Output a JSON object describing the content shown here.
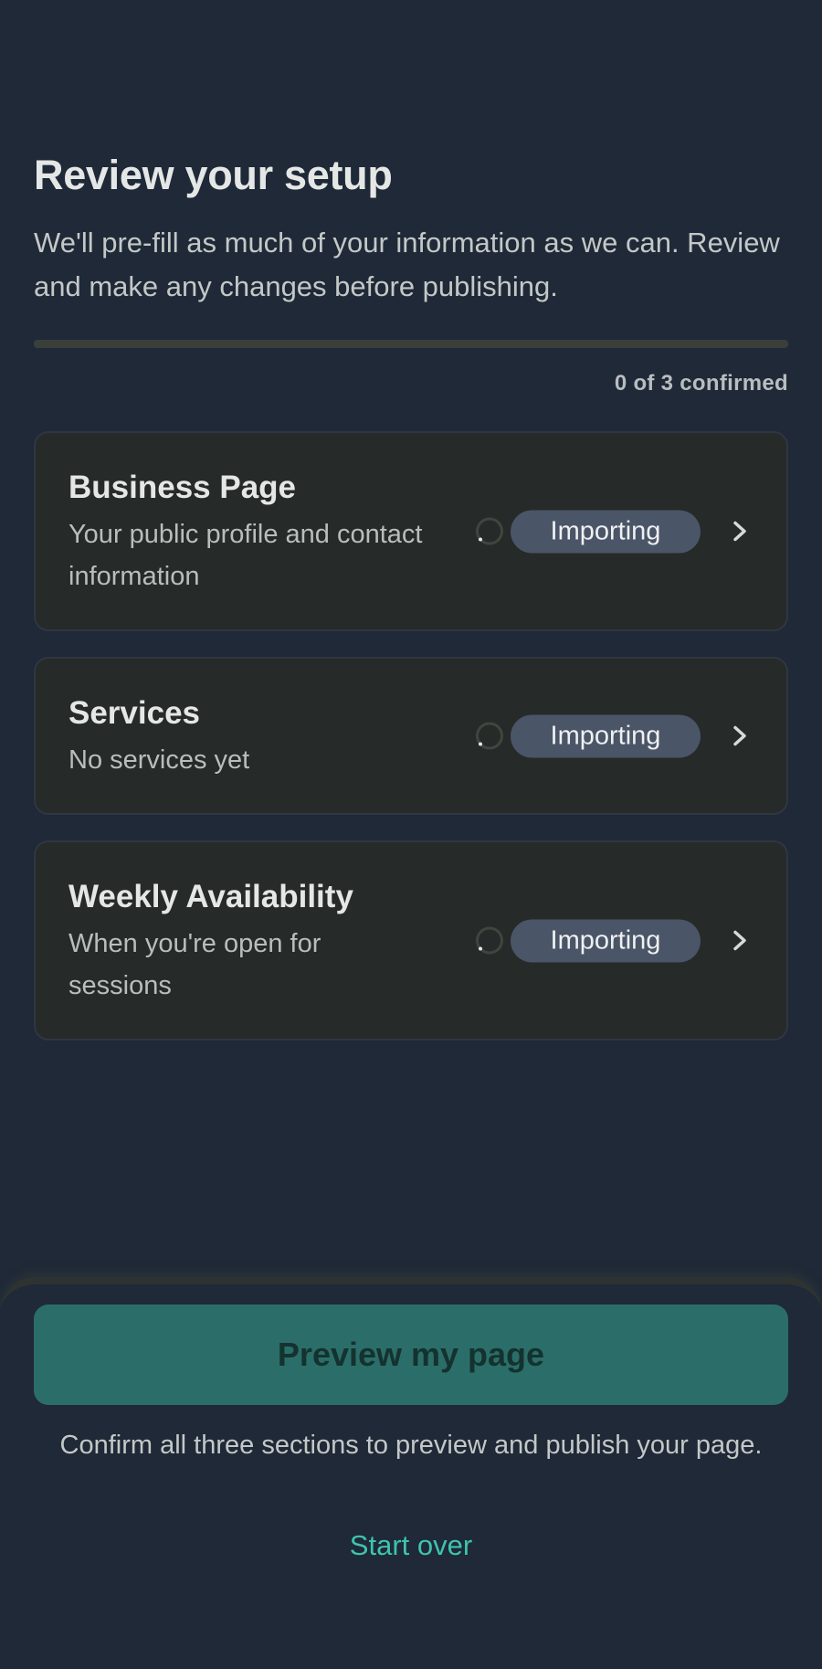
{
  "header": {
    "title": "Review your setup",
    "subtitle": "We'll pre-fill as much of your information as we can. Review and make any changes before publishing."
  },
  "progress": {
    "confirmed": 0,
    "total": 3,
    "fraction": 0,
    "label": "0 of 3 confirmed"
  },
  "sections": [
    {
      "title": "Business Page",
      "description": "Your public profile and contact information",
      "status": "Importing",
      "icon": "chevron-right-icon"
    },
    {
      "title": "Services",
      "description": "No services yet",
      "status": "Importing",
      "icon": "chevron-right-icon"
    },
    {
      "title": "Weekly Availability",
      "description": "When you're open for sessions",
      "status": "Importing",
      "icon": "chevron-right-icon"
    }
  ],
  "footer": {
    "preview_label": "Preview my page",
    "hint": "Confirm all three sections to preview and publish your page.",
    "start_over_label": "Start over"
  },
  "colors": {
    "background": "#1f2937",
    "card": "#262a29",
    "badge": "#4a5567",
    "accent": "#3fc3ad",
    "button_disabled": "#2b6e69"
  }
}
